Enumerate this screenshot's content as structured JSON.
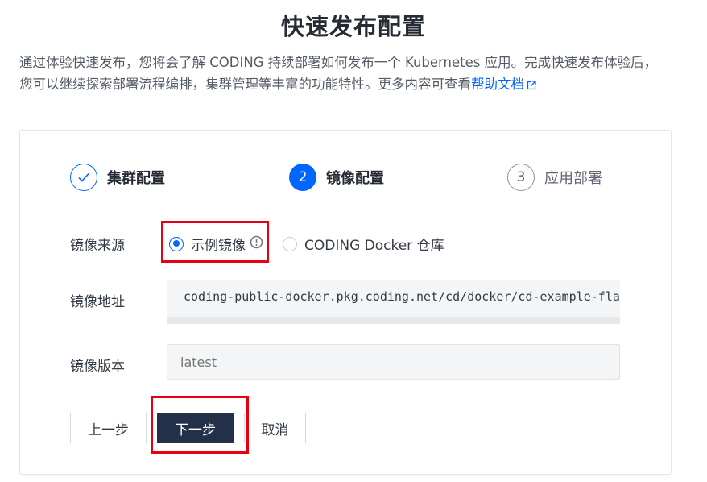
{
  "header": {
    "title": "快速发布配置",
    "intro_text": "通过体验快速发布，您将会了解 CODING 持续部署如何发布一个 Kubernetes 应用。完成快速发布体验后，您可以继续探索部署流程编排，集群管理等丰富的功能特性。更多内容可查看",
    "help_link": "帮助文档"
  },
  "steps": [
    {
      "index": "✓",
      "label": "集群配置",
      "state": "done"
    },
    {
      "index": "2",
      "label": "镜像配置",
      "state": "active"
    },
    {
      "index": "3",
      "label": "应用部署",
      "state": "todo"
    }
  ],
  "form": {
    "source_label": "镜像来源",
    "source_options": [
      {
        "label": "示例镜像",
        "checked": true
      },
      {
        "label": "CODING Docker 仓库",
        "checked": false
      }
    ],
    "address_label": "镜像地址",
    "address_value": "coding-public-docker.pkg.coding.net/cd/docker/cd-example-flask",
    "version_label": "镜像版本",
    "version_placeholder": "latest"
  },
  "buttons": {
    "prev": "上一步",
    "next": "下一步",
    "cancel": "取消"
  },
  "colors": {
    "primary": "#0066ff",
    "dark_button": "#22304a",
    "highlight": "#e60012"
  }
}
